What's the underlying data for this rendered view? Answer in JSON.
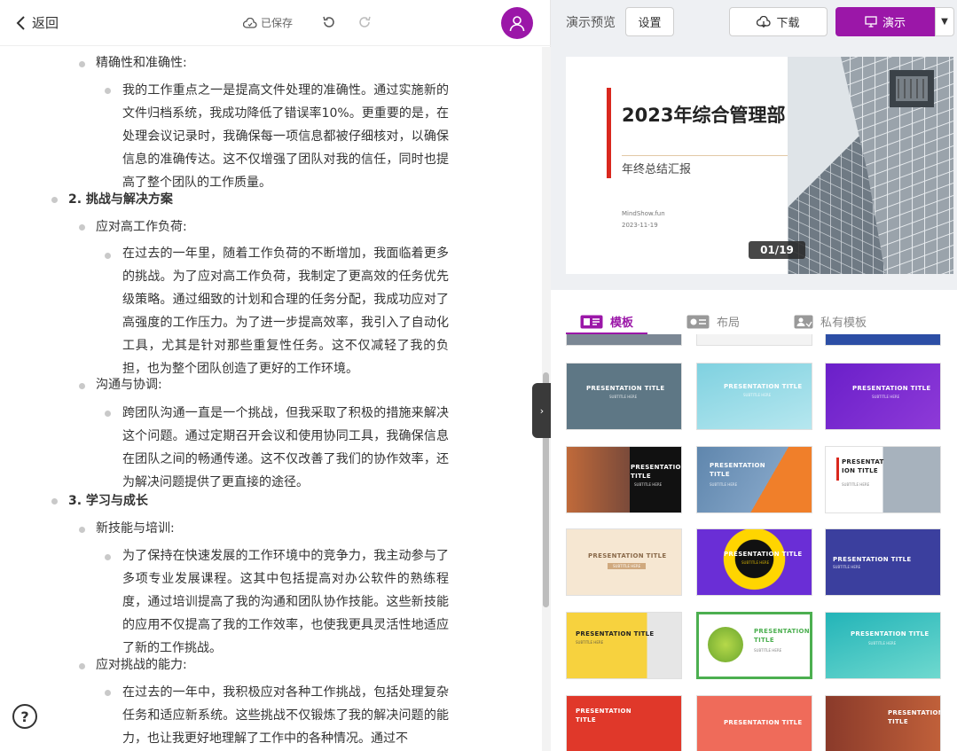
{
  "topbar": {
    "back_label": "返回",
    "saved_label": "已保存"
  },
  "outline": {
    "items": [
      {
        "text": "精确性和准确性:"
      },
      {
        "text": "我的工作重点之一是提高文件处理的准确性。通过实施新的文件归档系统，我成功降低了错误率10%。更重要的是，在处理会议记录时，我确保每一项信息都被仔细核对，以确保信息的准确传达。这不仅增强了团队对我的信任，同时也提高了整个团队的工作质量。"
      },
      {
        "text": "2. 挑战与解决方案"
      },
      {
        "text": "应对高工作负荷:"
      },
      {
        "text": "在过去的一年里，随着工作负荷的不断增加，我面临着更多的挑战。为了应对高工作负荷，我制定了更高效的任务优先级策略。通过细致的计划和合理的任务分配，我成功应对了高强度的工作压力。为了进一步提高效率，我引入了自动化工具，尤其是针对那些重复性任务。这不仅减轻了我的负担，也为整个团队创造了更好的工作环境。"
      },
      {
        "text": "沟通与协调:"
      },
      {
        "text": "跨团队沟通一直是一个挑战，但我采取了积极的措施来解决这个问题。通过定期召开会议和使用协同工具，我确保信息在团队之间的畅通传递。这不仅改善了我们的协作效率，还为解决问题提供了更直接的途径。"
      },
      {
        "text": "3. 学习与成长"
      },
      {
        "text": "新技能与培训:"
      },
      {
        "text": "为了保持在快速发展的工作环境中的竞争力，我主动参与了多项专业发展课程。这其中包括提高对办公软件的熟练程度，通过培训提高了我的沟通和团队协作技能。这些新技能的应用不仅提高了我的工作效率，也使我更具灵活性地适应了新的工作挑战。"
      },
      {
        "text": "应对挑战的能力:"
      },
      {
        "text": "在过去的一年中，我积极应对各种工作挑战，包括处理复杂任务和适应新系统。这些挑战不仅锻炼了我的解决问题的能力，也让我更好地理解了工作中的各种情况。通过不"
      }
    ]
  },
  "right": {
    "preview_label": "演示预览",
    "settings_label": "设置",
    "download_label": "下载",
    "present_label": "演示",
    "slide": {
      "title": "2023年综合管理部",
      "subtitle": "年终总结汇报",
      "author": "MindShow.fun",
      "date": "2023-11-19",
      "page_indicator": "01/19"
    },
    "tabs": [
      {
        "label": "模板"
      },
      {
        "label": "布局"
      },
      {
        "label": "私有模板"
      }
    ],
    "templates": [
      {
        "title": "PRESENTATION TITLE",
        "subtitle": "SUBTITLE HERE"
      },
      {
        "title": "PRESENTATION TITLE",
        "subtitle": "SUBTITLE HERE"
      },
      {
        "title": "PRESENTATION TITLE",
        "subtitle": "SUBTITLE HERE"
      },
      {
        "title": "PRESENTATION TITLE",
        "subtitle": "SUBTITLE HERE"
      },
      {
        "title": "PRESENTATION TITLE",
        "subtitle": "SUBTITLE HERE"
      },
      {
        "title": "PRESENTAT ION TITLE",
        "subtitle": "SUBTITLE HERE"
      },
      {
        "title": "PRESENTATION TITLE",
        "subtitle": "SUBTITLE HERE"
      },
      {
        "title": "PRESENTATION TITLE",
        "subtitle": "SUBTITLE HERE"
      },
      {
        "title": "PRESENTATION TITLE",
        "subtitle": "SUBTITLE HERE"
      },
      {
        "title": "PRESENTATION TITLE",
        "subtitle": "SUBTITLE HERE"
      },
      {
        "title": "PRESENTATION TITLE",
        "subtitle": "SUBTITLE HERE"
      },
      {
        "title": "PRESENTATION TITLE",
        "subtitle": "SUBTITLE HERE"
      },
      {
        "title": "PRESENTATION TITLE",
        "subtitle": ""
      },
      {
        "title": "PRESENTATION TITLE",
        "subtitle": ""
      },
      {
        "title": "PRESENTATION TITLE",
        "subtitle": ""
      }
    ]
  },
  "colors": {
    "accent": "#9b17a8",
    "slide_bar": "#d9281e"
  }
}
